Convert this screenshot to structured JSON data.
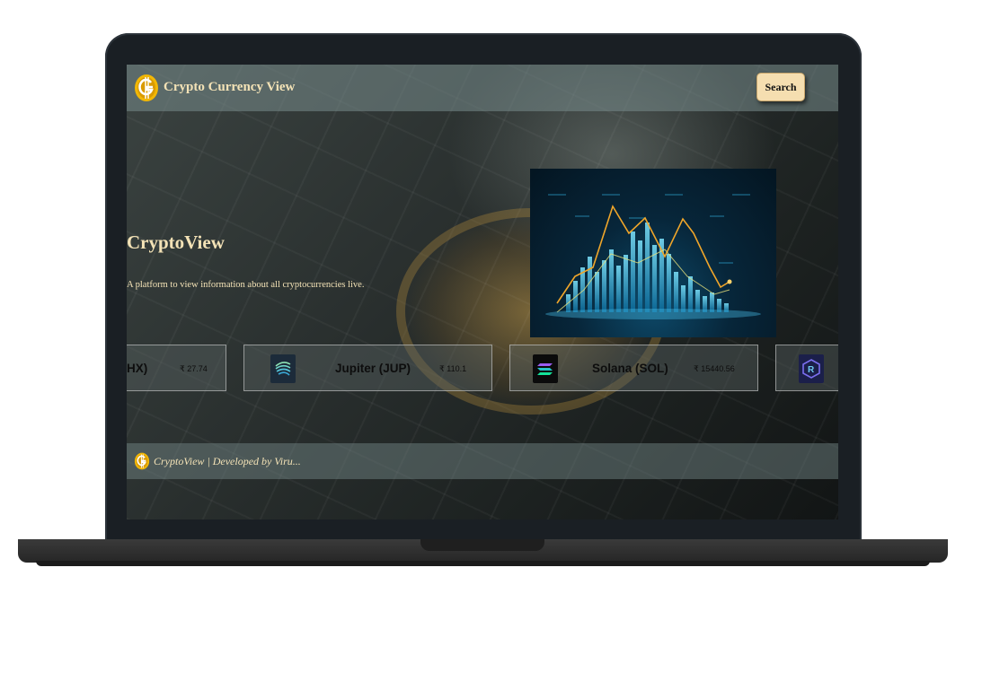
{
  "header": {
    "site_title": "Crypto Currency View",
    "search_label": "Search",
    "logo_icon": "crypto-g-coin-icon"
  },
  "hero": {
    "title": "CryptoView",
    "subtitle": "A platform to view information about all cryptocurrencies live."
  },
  "ticker": {
    "coins": [
      {
        "name": "SHX)",
        "price": "₹ 27.74",
        "icon": "stronghold-icon"
      },
      {
        "name": "Jupiter (JUP)",
        "price": "₹ 110.1",
        "icon": "jupiter-icon"
      },
      {
        "name": "Solana (SOL)",
        "price": "₹ 15440.56",
        "icon": "solana-icon"
      },
      {
        "name": "",
        "price": "",
        "icon": "raydium-icon"
      }
    ]
  },
  "footer": {
    "text": "CryptoView  |  Developed by Viru..."
  },
  "colors": {
    "accent_gold": "#f3e2b6",
    "button_bg": "#f5deb0",
    "laptop_frame": "#1a1f24"
  }
}
